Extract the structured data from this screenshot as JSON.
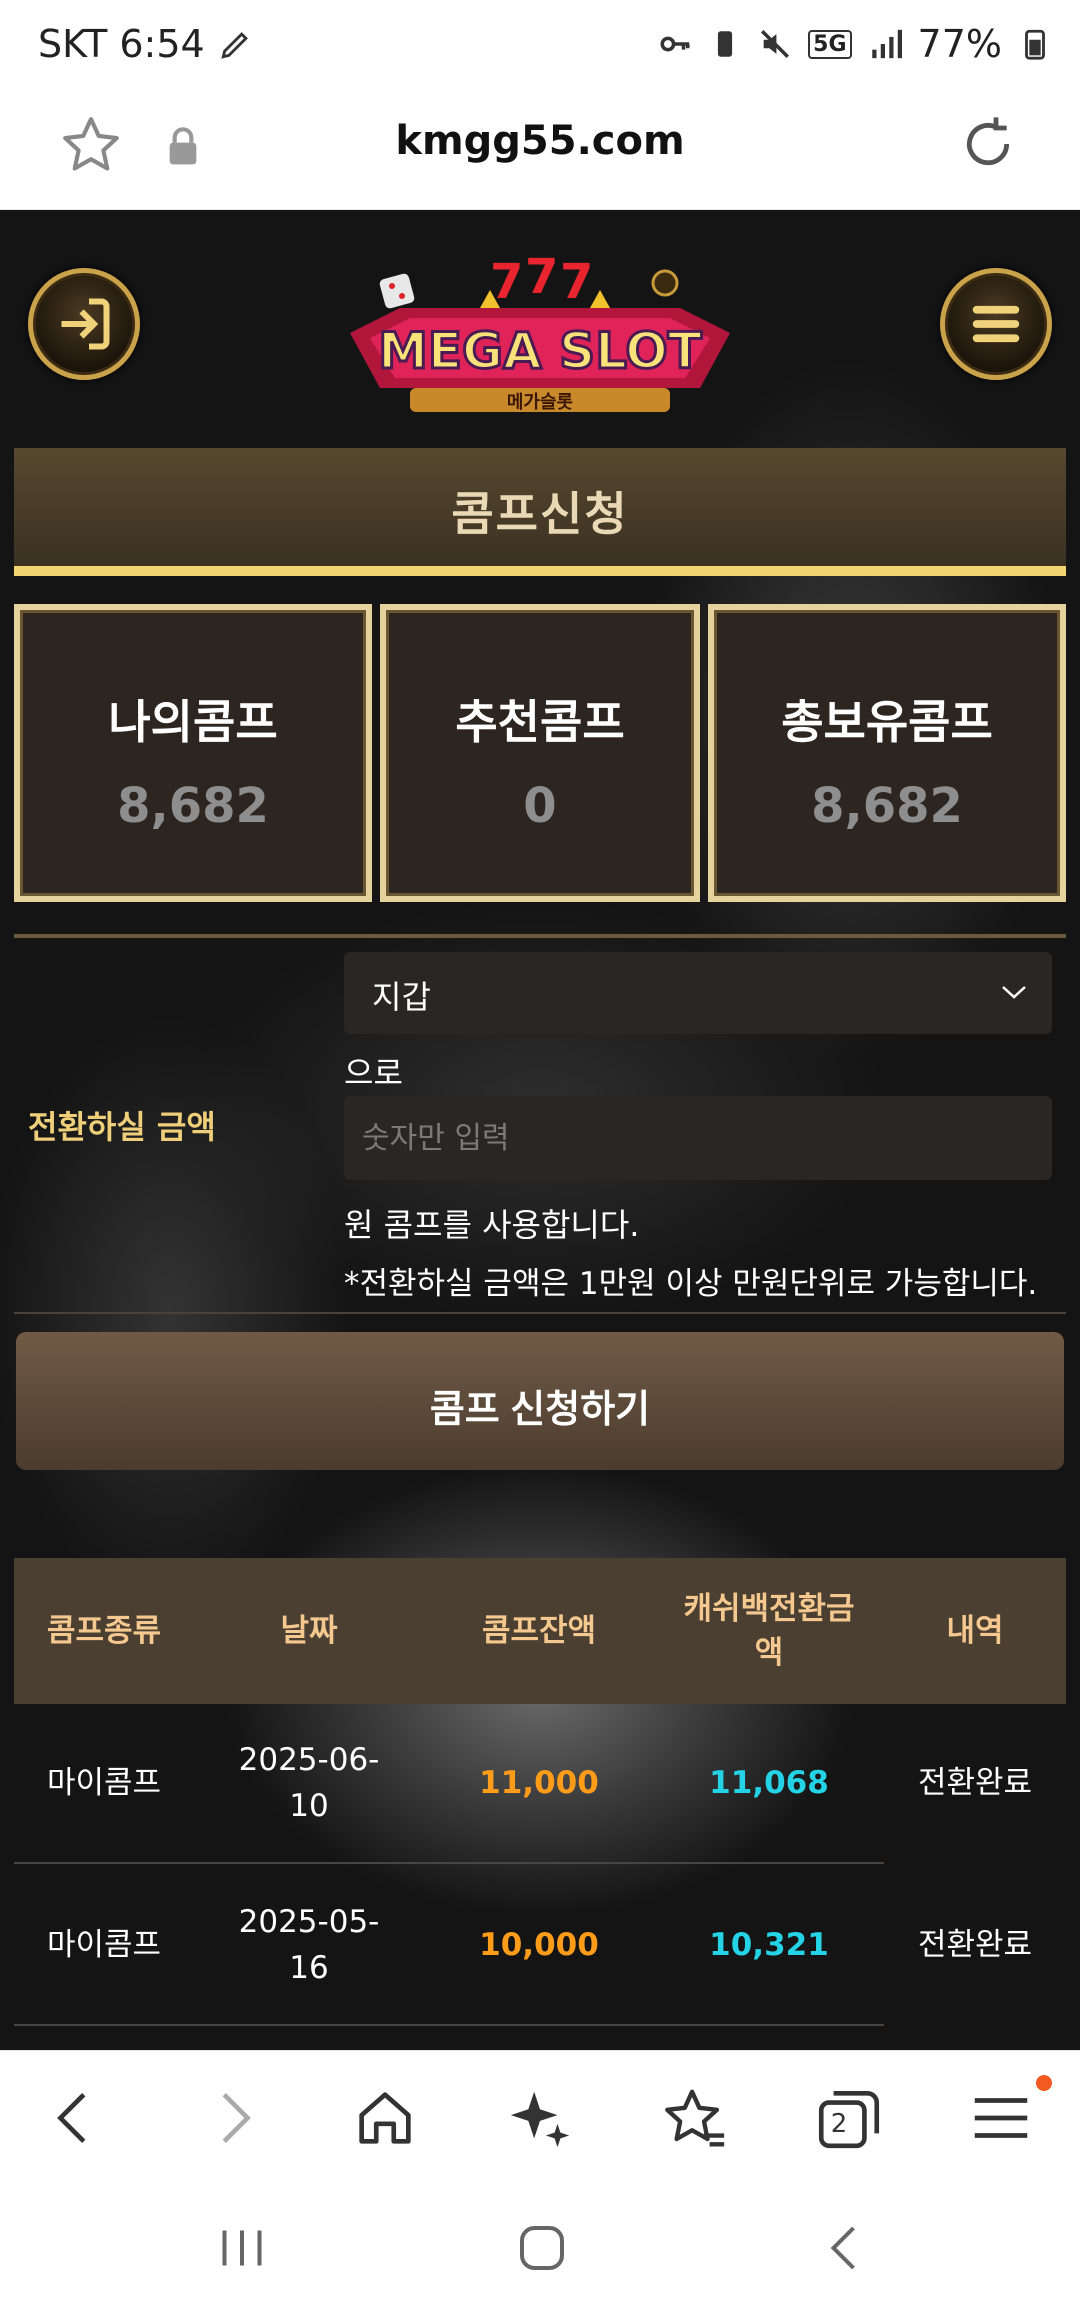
{
  "status_bar": {
    "carrier_time": "SKT 6:54",
    "battery": "77%",
    "network": "5G"
  },
  "browser": {
    "url": "kmgg55.com"
  },
  "header": {
    "logo_text": "MEGA SLOT",
    "logo_subtext": "메가슬롯"
  },
  "page_title": "콤프신청",
  "stats": [
    {
      "label": "나의콤프",
      "value": "8,682"
    },
    {
      "label": "추천콤프",
      "value": "0"
    },
    {
      "label": "총보유콤프",
      "value": "8,682"
    }
  ],
  "form": {
    "label": "전환하실 금액",
    "select_value": "지갑",
    "select_suffix": "으로",
    "amount_placeholder": "숫자만 입력",
    "note_use": "원 콤프를 사용합니다.",
    "note_rule": "*전환하실 금액은 1만원 이상 만원단위로 가능합니다."
  },
  "apply_button": "콤프 신청하기",
  "table": {
    "headers": [
      "콤프종류",
      "날짜",
      "콤프잔액",
      "캐쉬백전환금\n액",
      "내역"
    ],
    "rows": [
      {
        "type": "마이콤프",
        "date": "2025-06-\n10",
        "balance": "11,000",
        "cashback": "11,068",
        "status": "전환완료"
      },
      {
        "type": "마이콤프",
        "date": "2025-05-\n16",
        "balance": "10,000",
        "cashback": "10,321",
        "status": "전환완료"
      }
    ]
  },
  "browser_nav": {
    "tab_count": "2"
  },
  "colors": {
    "accent_gold": "#f1d571",
    "balance_orange": "#ff9c1a",
    "cashback_cyan": "#24d3e6"
  }
}
